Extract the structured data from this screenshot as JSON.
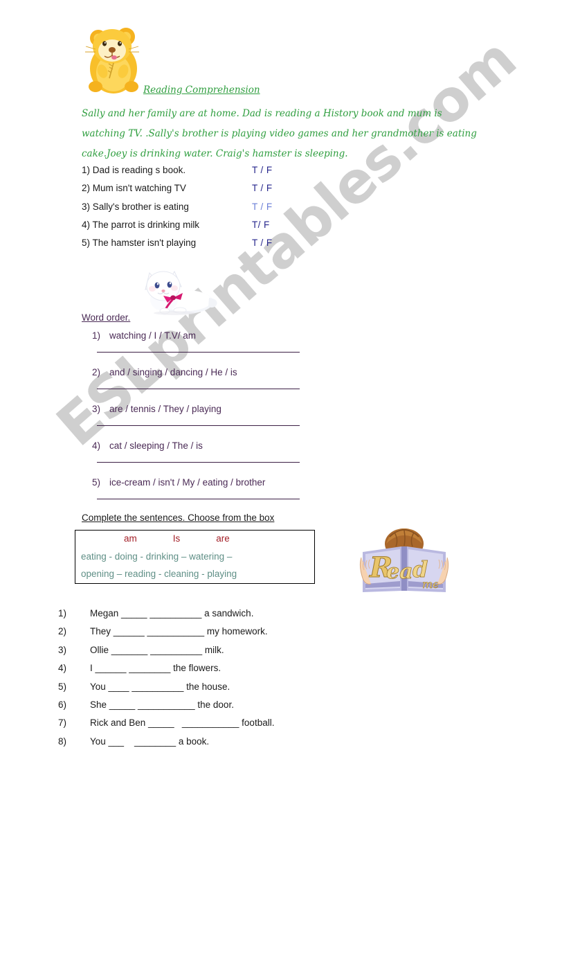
{
  "watermark": "ESLprintables.com",
  "header": {
    "title": "Reading Comprehension",
    "hamster_icon": "hamster-illustration"
  },
  "passage": {
    "lines": [
      "Sally and her family are at home. Dad is reading a History book and mum is",
      "watching TV. .Sally's brother is playing video games and her grandmother is eating",
      "cake.Joey is drinking water. Craig's hamster is sleeping."
    ]
  },
  "true_false": {
    "items": [
      {
        "question": "1) Dad is reading s book.",
        "answer": "T / F",
        "light": false
      },
      {
        "question": "2) Mum isn't watching TV",
        "answer": "T / F",
        "light": false
      },
      {
        "question": "3) Sally's brother is eating",
        "answer": "T / F",
        "light": true
      },
      {
        "question": "4) The parrot is drinking milk",
        "answer": "T/ F",
        "light": false
      },
      {
        "question": "5) The hamster isn't playing",
        "answer": "T / F",
        "light": false
      }
    ]
  },
  "cat_icon": "cat-illustration",
  "word_order": {
    "heading": "Word order.",
    "items": [
      {
        "num": "1)",
        "text": "watching / I / T.V/  am"
      },
      {
        "num": "2)",
        "text": "and / singing / dancing / He / is"
      },
      {
        "num": "3)",
        "text": "are / tennis / They / playing"
      },
      {
        "num": "4)",
        "text": "cat / sleeping / The / is"
      },
      {
        "num": "5)",
        "text": "ice-cream / isn't / My / eating / brother"
      }
    ]
  },
  "complete": {
    "heading": "Complete the sentences. Choose from the box",
    "box": {
      "aux": [
        "am",
        "Is",
        "are"
      ],
      "verbs_line1": "eating -  doing  -  drinking – watering –",
      "verbs_line2": "opening –  reading -  cleaning    -   playing"
    },
    "readme_icon": "read-me-book-illustration",
    "sentences": [
      {
        "num": "1)",
        "text": "Megan _____ __________ a sandwich."
      },
      {
        "num": "2)",
        "text": "They ______ ___________ my homework."
      },
      {
        "num": "3)",
        "text": "Ollie _______ __________ milk."
      },
      {
        "num": "4)",
        "text": "I ______ ________ the flowers."
      },
      {
        "num": "5)",
        "text": "You ____ __________ the house."
      },
      {
        "num": "6)",
        "text": "She _____ ___________ the door."
      },
      {
        "num": "7)",
        "text": "Rick and Ben _____   ___________ football."
      },
      {
        "num": "8)",
        "text": "You ___    ________ a book."
      }
    ]
  },
  "colors": {
    "green": "#2f9e3f",
    "purple": "#4a2a55",
    "blue": "#26268c",
    "blue_light": "#6b7fd7",
    "red": "#a31f27",
    "teal": "#5f8f86",
    "watermark": "#cfcfcf"
  }
}
